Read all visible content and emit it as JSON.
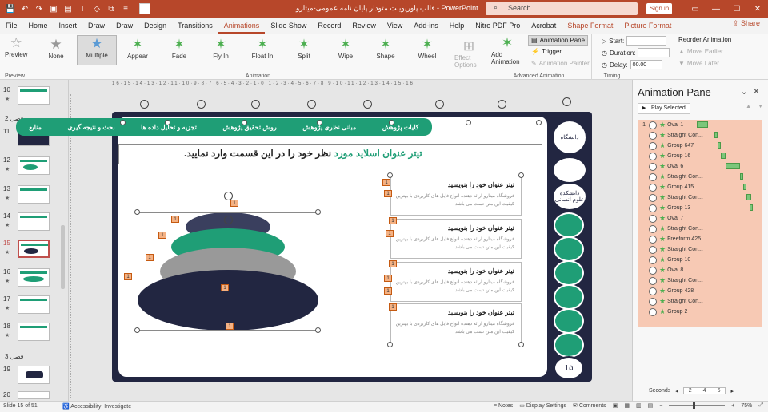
{
  "window": {
    "title": "قالب پاورپوینت متودار پایان نامه عمومی-میتارو  -  PowerPoint",
    "search_placeholder": "Search",
    "signin": "Sign in",
    "share": "Share"
  },
  "tabs": [
    "File",
    "Home",
    "Insert",
    "Draw",
    "Draw",
    "Design",
    "Transitions",
    "Animations",
    "Slide Show",
    "Record",
    "Review",
    "View",
    "Add-ins",
    "Help",
    "Nitro PDF Pro",
    "Acrobat",
    "Shape Format",
    "Picture Format"
  ],
  "active_tab": "Animations",
  "ribbon": {
    "preview": {
      "label": "Preview",
      "group": "Preview"
    },
    "animations": [
      "None",
      "Multiple",
      "Appear",
      "Fade",
      "Fly In",
      "Float In",
      "Split",
      "Wipe",
      "Shape",
      "Wheel"
    ],
    "effect_options": "Effect Options",
    "animation_group": "Animation",
    "add_animation": "Add Animation",
    "animation_pane": "Animation Pane",
    "trigger": "Trigger",
    "animation_painter": "Animation Painter",
    "advanced_group": "Advanced Animation",
    "start_label": "Start:",
    "duration_label": "Duration:",
    "delay_label": "Delay:",
    "delay_value": "00.00",
    "reorder": "Reorder Animation",
    "move_earlier": "Move Earlier",
    "move_later": "Move Later",
    "timing_group": "Timing"
  },
  "thumbnails": {
    "sections": [
      "فصل 2",
      "فصل 3"
    ],
    "slides": [
      "10",
      "11",
      "12",
      "13",
      "14",
      "15",
      "16",
      "17",
      "18",
      "19",
      "20"
    ]
  },
  "slide": {
    "nav": [
      "کلیات پژوهش",
      "مبانی نظری پژوهش",
      "روش تحقیق پژوهش",
      "تجزیه و تحلیل داده ها",
      "بحث و نتیجه گیری",
      "منابع"
    ],
    "title_green": "تیتر عنوان اسلاید مورد",
    "title_dark": " نظر خود را در این قسمت وارد نمایید.",
    "card_title": "تیتر عنوان خود را بنویسید",
    "card_body": "فروشگاه میتارو ارائه دهنده انواع فایل های کاربردی با بهترین کیفیت این متن تست می باشد",
    "side_labels": [
      "دانشگاه",
      "دانشکده علوم انسانی",
      "1۵"
    ],
    "tag": "1"
  },
  "pane": {
    "title": "Animation Pane",
    "play": "Play Selected",
    "items": [
      {
        "n": "1",
        "name": "Oval 1"
      },
      {
        "n": "",
        "name": "Straight Con..."
      },
      {
        "n": "",
        "name": "Group 647"
      },
      {
        "n": "",
        "name": "Group 16"
      },
      {
        "n": "",
        "name": "Oval 6"
      },
      {
        "n": "",
        "name": "Straight Con..."
      },
      {
        "n": "",
        "name": "Group 415"
      },
      {
        "n": "",
        "name": "Straight Con..."
      },
      {
        "n": "",
        "name": "Group 13"
      },
      {
        "n": "",
        "name": "Oval 7"
      },
      {
        "n": "",
        "name": "Straight Con..."
      },
      {
        "n": "",
        "name": "Freeform 425"
      },
      {
        "n": "",
        "name": "Straight Con..."
      },
      {
        "n": "",
        "name": "Group 10"
      },
      {
        "n": "",
        "name": "Oval 8"
      },
      {
        "n": "",
        "name": "Straight Con..."
      },
      {
        "n": "",
        "name": "Group 428"
      },
      {
        "n": "",
        "name": "Straight Con..."
      },
      {
        "n": "",
        "name": "Group 2"
      }
    ],
    "seconds_label": "Seconds",
    "scale": [
      "2",
      "4",
      "6"
    ]
  },
  "status": {
    "slide": "Slide 15 of 51",
    "accessibility": "Accessibility: Investigate",
    "notes": "Notes",
    "display": "Display Settings",
    "comments": "Comments",
    "zoom": "75%"
  },
  "colors": {
    "accent": "#b7472a",
    "green": "#1f9e76",
    "navy": "#222641"
  }
}
